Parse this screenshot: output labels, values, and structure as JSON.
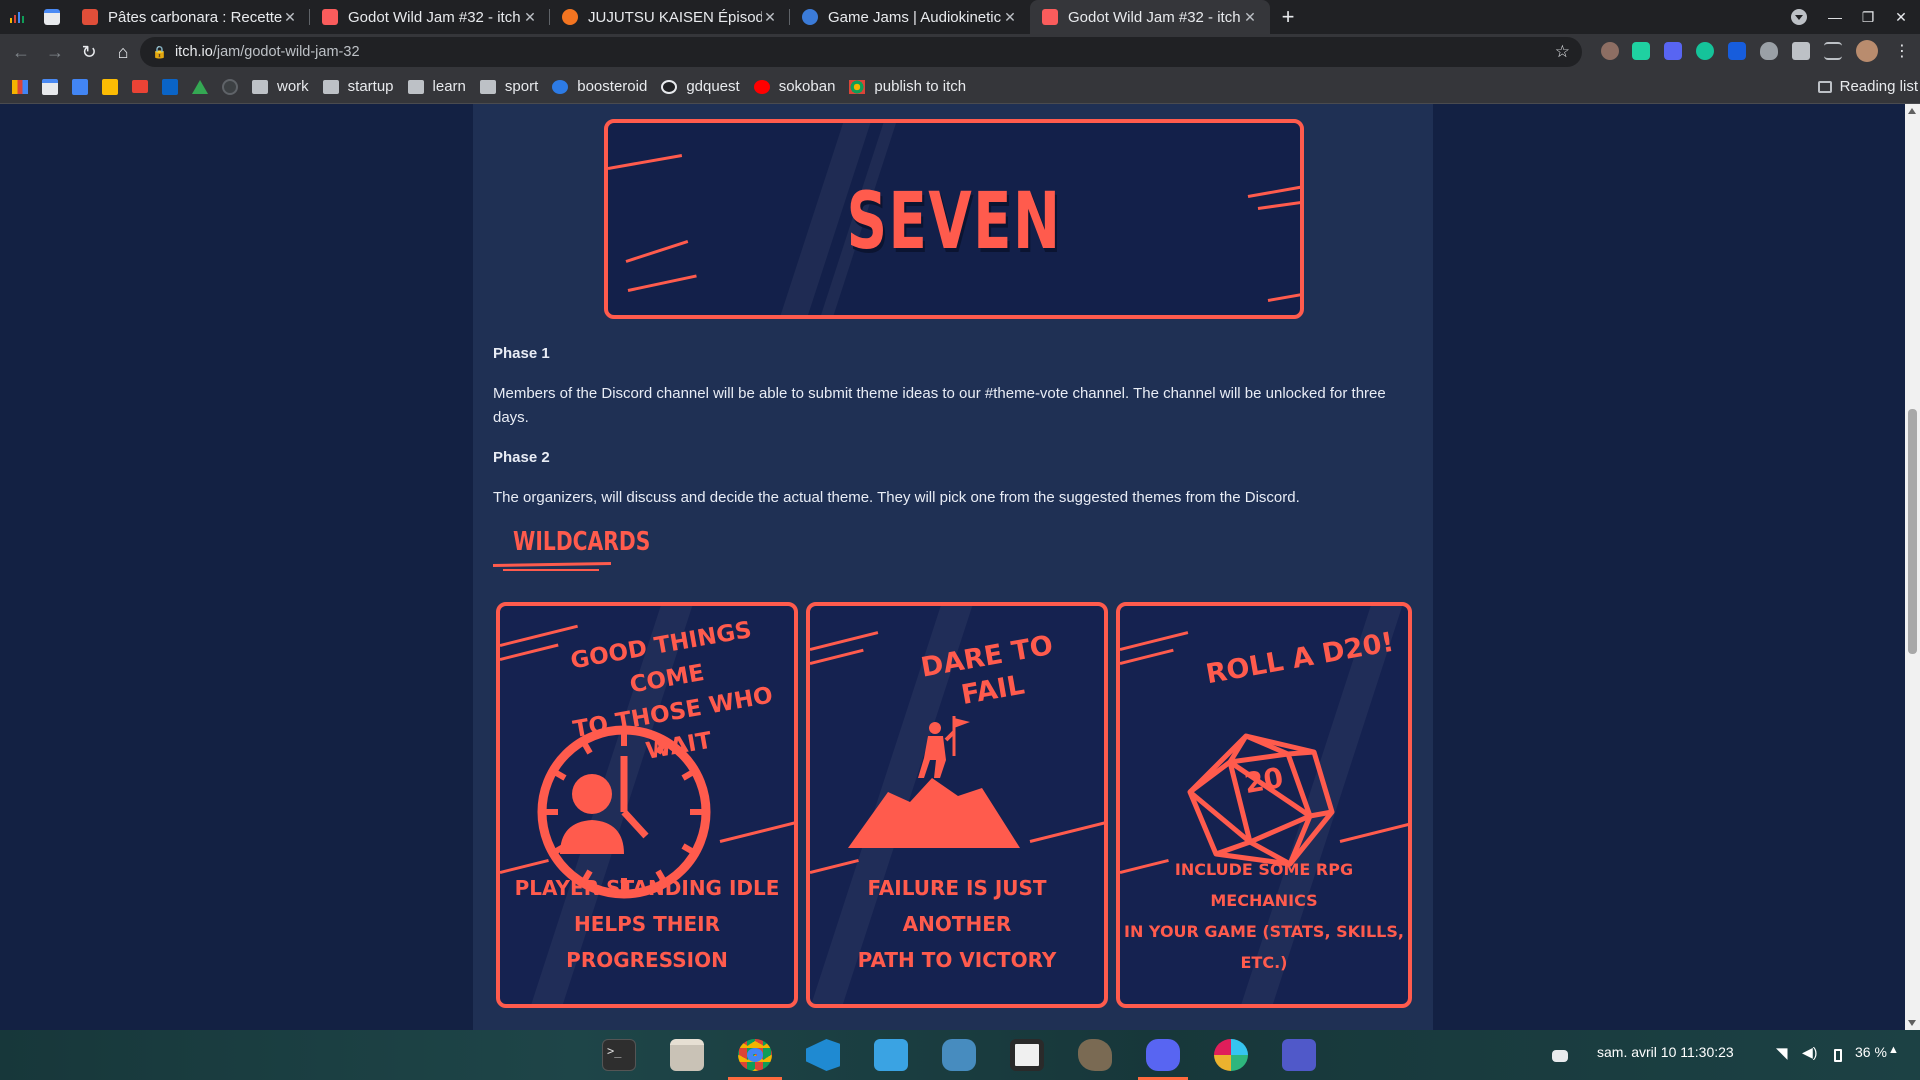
{
  "tabs": [
    {
      "label": "Pâtes carbonara : Recette",
      "color": "#e04e39"
    },
    {
      "label": "Godot Wild Jam #32 - itch",
      "color": "#fa5c5c"
    },
    {
      "label": "JUJUTSU KAISEN Épisode",
      "color": "#f47521"
    },
    {
      "label": "Game Jams | Audiokinetic",
      "color": "#3b7bd8"
    },
    {
      "label": "Godot Wild Jam #32 - itch",
      "color": "#fa5c5c"
    }
  ],
  "address": {
    "host": "itch.io",
    "path": "/jam/godot-wild-jam-32"
  },
  "bookmarks": [
    "work",
    "startup",
    "learn",
    "sport",
    "boosteroid",
    "gdquest",
    "sokoban",
    "publish to itch"
  ],
  "reading_list": "Reading list",
  "banner_word": "SEVEN",
  "phase1": {
    "title": "Phase 1",
    "body": "Members of the Discord channel will be able to submit theme ideas to our #theme-vote channel. The channel will be unlocked for three days."
  },
  "phase2": {
    "title": "Phase 2",
    "body": "The organizers, will discuss and decide the actual theme. They will pick one from the suggested themes from the Discord."
  },
  "wildcards_heading": "WILDCARDS",
  "cards": [
    {
      "title_line1": "GOOD THINGS COME",
      "title_line2": "TO THOSE WHO WAIT",
      "desc_line1": "PLAYER STANDING IDLE",
      "desc_line2": "HELPS THEIR PROGRESSION"
    },
    {
      "title_line1": "DARE TO FAIL",
      "desc_line1": "FAILURE IS JUST ANOTHER",
      "desc_line2": "PATH TO VICTORY"
    },
    {
      "title_line1": "ROLL A D20!",
      "die_number": "20",
      "desc_line1": "INCLUDE SOME RPG MECHANICS",
      "desc_line2": "IN YOUR GAME (STATS, SKILLS, ETC.)"
    }
  ],
  "clock": "sam. avril 10  11:30:23",
  "battery": "36 %",
  "accent": "#ff5b4d",
  "page_bg": "#132143"
}
